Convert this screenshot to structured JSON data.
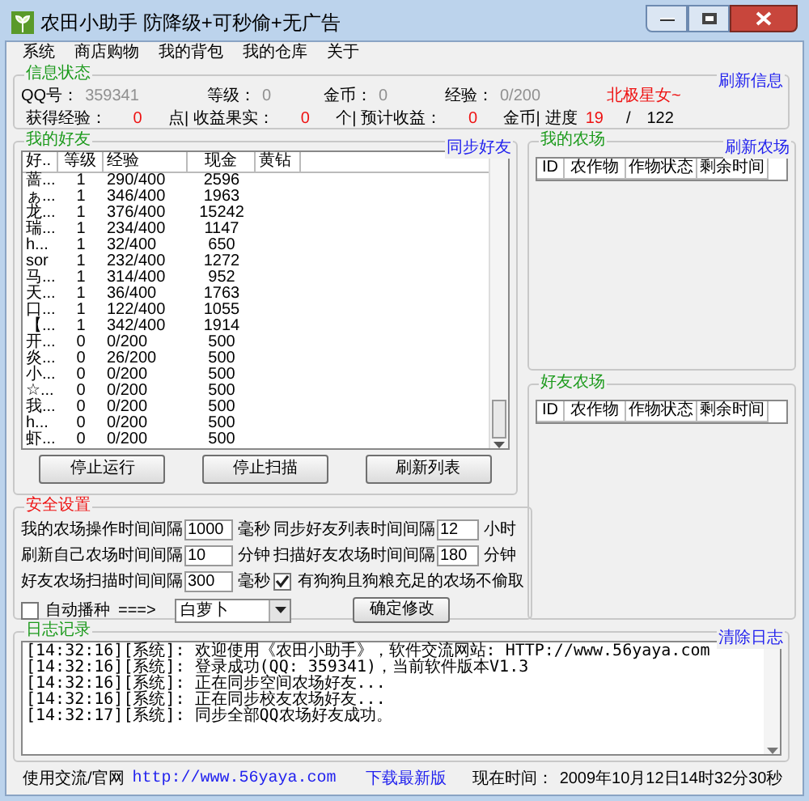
{
  "window": {
    "title": "农田小助手 防降级+可秒偷+无广告"
  },
  "menu": [
    "系统",
    "商店购物",
    "我的背包",
    "我的仓库",
    "关于"
  ],
  "info": {
    "legend": "信息状态",
    "action": "刷新信息",
    "row1": [
      {
        "label": "QQ号：",
        "value": "359341"
      },
      {
        "label": "等级：",
        "value": "0"
      },
      {
        "label": "金币：",
        "value": "0"
      },
      {
        "label": "经验：",
        "value": "0/200"
      }
    ],
    "nickname": "北极星女~",
    "row2": [
      {
        "label": "获得经验：",
        "value": "0",
        "unit": "点|"
      },
      {
        "label": "收益果实：",
        "value": "0",
        "unit": "个|"
      },
      {
        "label": "预计收益：",
        "value": "0",
        "unit": "金币|"
      }
    ],
    "progress": {
      "label": "进度",
      "done": "19",
      "separator": "/",
      "total": "122"
    }
  },
  "friends": {
    "legend": "我的好友",
    "action": "同步好友",
    "columns": [
      "好..",
      "等级",
      "经验",
      "现金",
      "黄钻"
    ],
    "rows": [
      [
        "蔷...",
        "1",
        "290/400",
        "2596"
      ],
      [
        "ぁ...",
        "1",
        "346/400",
        "1963"
      ],
      [
        "龙...",
        "1",
        "376/400",
        "15242"
      ],
      [
        "瑞...",
        "1",
        "234/400",
        "1147"
      ],
      [
        "h...",
        "1",
        "32/400",
        "650"
      ],
      [
        "sor",
        "1",
        "232/400",
        "1272"
      ],
      [
        "马...",
        "1",
        "314/400",
        "952"
      ],
      [
        "天...",
        "1",
        "36/400",
        "1763"
      ],
      [
        "口...",
        "1",
        "122/400",
        "1055"
      ],
      [
        "【...",
        "1",
        "342/400",
        "1914"
      ],
      [
        "开...",
        "0",
        "0/200",
        "500"
      ],
      [
        "炎...",
        "0",
        "26/200",
        "500"
      ],
      [
        "小...",
        "0",
        "0/200",
        "500"
      ],
      [
        "☆...",
        "0",
        "0/200",
        "500"
      ],
      [
        "我...",
        "0",
        "0/200",
        "500"
      ],
      [
        "h...",
        "0",
        "0/200",
        "500"
      ],
      [
        "虾...",
        "0",
        "0/200",
        "500"
      ]
    ],
    "buttons": [
      "停止运行",
      "停止扫描",
      "刷新列表"
    ]
  },
  "my_farm": {
    "legend": "我的农场",
    "action": "刷新农场",
    "columns": [
      "ID",
      "农作物",
      "作物状态",
      "剩余时间"
    ]
  },
  "friend_farm": {
    "legend": "好友农场",
    "columns": [
      "ID",
      "农作物",
      "作物状态",
      "剩余时间"
    ]
  },
  "safety": {
    "legend": "安全设置",
    "items": [
      {
        "kind": "field",
        "label": "我的农场操作时间间隔",
        "value": "1000",
        "unit": "毫秒"
      },
      {
        "kind": "field",
        "label": "同步好友列表时间间隔",
        "value": "12",
        "unit": "小时"
      },
      {
        "kind": "field",
        "label": "刷新自己农场时间间隔",
        "value": "10",
        "unit": "分钟"
      },
      {
        "kind": "field",
        "label": "扫描好友农场时间间隔",
        "value": "180",
        "unit": "分钟"
      },
      {
        "kind": "field",
        "label": "好友农场扫描时间间隔",
        "value": "300",
        "unit": "毫秒"
      },
      {
        "kind": "checkbox",
        "label": "有狗狗且狗粮充足的农场不偷取",
        "checked": true
      }
    ],
    "auto_sow": {
      "label": "自动播种",
      "checked": false,
      "arrow": "===>",
      "crop": "白萝卜"
    },
    "confirm": "确定修改"
  },
  "log": {
    "legend": "日志记录",
    "action": "清除日志",
    "lines": [
      "[14:32:16][系统]: 欢迎使用《农田小助手》，软件交流网站: HTTP://www.56yaya.com",
      "[14:32:16][系统]: 登录成功(QQ: 359341)，当前软件版本V1.3",
      "[14:32:16][系统]: 正在同步空间农场好友...",
      "[14:32:16][系统]: 正在同步校友农场好友...",
      "[14:32:17][系统]: 同步全部QQ农场好友成功。"
    ]
  },
  "status_bar": {
    "label": "使用交流/官网",
    "url": "http://www.56yaya.com",
    "download": "下载最新版",
    "time_label": "现在时间：",
    "time": "2009年10月12日14时32分30秒"
  }
}
